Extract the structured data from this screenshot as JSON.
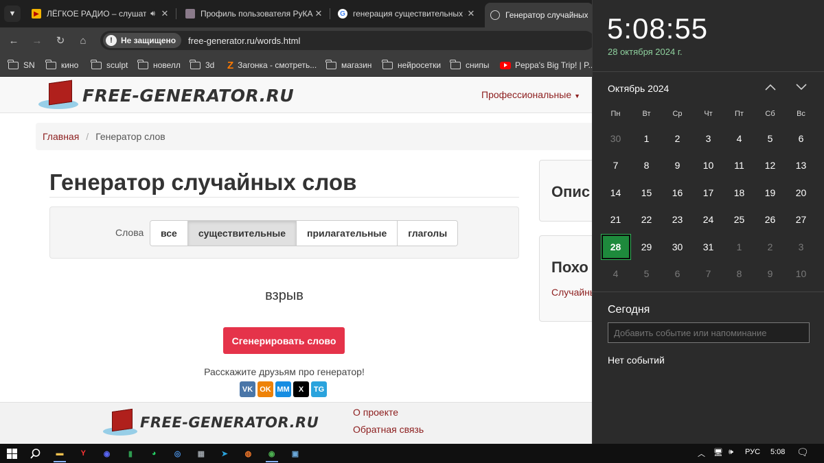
{
  "browser": {
    "tabs": [
      {
        "title": "ЛЁГКОЕ РАДИО – слушать",
        "favicon": "play-icon",
        "playing": true
      },
      {
        "title": "Профиль пользователя РуКАМ",
        "favicon": "site-favicon"
      },
      {
        "title": "генерация существительных -",
        "favicon": "google-icon"
      },
      {
        "title": "Генератор случайных сл",
        "favicon": "globe-icon",
        "active": true
      }
    ],
    "security_label": "Не защищено",
    "url": "free-generator.ru/words.html",
    "bookmarks": [
      {
        "label": "SN",
        "type": "folder"
      },
      {
        "label": "кино",
        "type": "folder"
      },
      {
        "label": "sculpt",
        "type": "folder"
      },
      {
        "label": "новелл",
        "type": "folder"
      },
      {
        "label": "3d",
        "type": "folder"
      },
      {
        "label": "Загонка - смотреть...",
        "type": "z-link"
      },
      {
        "label": "магазин",
        "type": "folder"
      },
      {
        "label": "нейросетки",
        "type": "folder"
      },
      {
        "label": "снипы",
        "type": "folder"
      },
      {
        "label": "Peppa's Big Trip! | P...",
        "type": "youtube-link"
      }
    ]
  },
  "site": {
    "logo_text": "FREE-GENERATOR.RU",
    "nav_menu": "Профессиональные",
    "breadcrumb": {
      "home": "Главная",
      "sep": "/",
      "current": "Генератор слов"
    },
    "title": "Генератор случайных слов",
    "filter_label": "Слова",
    "filters": [
      {
        "label": "все"
      },
      {
        "label": "существительные",
        "active": true
      },
      {
        "label": "прилагательные"
      },
      {
        "label": "глаголы"
      }
    ],
    "result": "взрыв",
    "generate_button": "Сгенерировать слово",
    "share_text": "Расскажите друзьям про генератор!",
    "share_buttons": [
      {
        "label": "VK",
        "icon": "vk-icon",
        "color": "#4a76a8"
      },
      {
        "label": "OK",
        "icon": "odnoklassniki-icon",
        "color": "#ee8208"
      },
      {
        "label": "MM",
        "icon": "mailru-icon",
        "color": "#168de2"
      },
      {
        "label": "X",
        "icon": "x-icon",
        "color": "#000000"
      },
      {
        "label": "TG",
        "icon": "telegram-icon",
        "color": "#2aa3dd"
      }
    ],
    "side_cards": [
      {
        "heading": "Опис"
      },
      {
        "heading": "Похо",
        "link": "Случайны"
      }
    ],
    "footer_links": [
      "О проекте",
      "Обратная связь"
    ],
    "accent_color": "#8c1d1d",
    "button_color": "#e5334a"
  },
  "calendar": {
    "time": "5:08:55",
    "date": "28 октября 2024 г.",
    "month_title": "Октябрь 2024",
    "weekdays": [
      "Пн",
      "Вт",
      "Ср",
      "Чт",
      "Пт",
      "Сб",
      "Вс"
    ],
    "days": [
      {
        "d": "30",
        "muted": true
      },
      {
        "d": "1"
      },
      {
        "d": "2"
      },
      {
        "d": "3"
      },
      {
        "d": "4"
      },
      {
        "d": "5"
      },
      {
        "d": "6"
      },
      {
        "d": "7"
      },
      {
        "d": "8"
      },
      {
        "d": "9"
      },
      {
        "d": "10"
      },
      {
        "d": "11"
      },
      {
        "d": "12"
      },
      {
        "d": "13"
      },
      {
        "d": "14"
      },
      {
        "d": "15"
      },
      {
        "d": "16"
      },
      {
        "d": "17"
      },
      {
        "d": "18"
      },
      {
        "d": "19"
      },
      {
        "d": "20"
      },
      {
        "d": "21"
      },
      {
        "d": "22"
      },
      {
        "d": "23"
      },
      {
        "d": "24"
      },
      {
        "d": "25"
      },
      {
        "d": "26"
      },
      {
        "d": "27"
      },
      {
        "d": "28",
        "today": true
      },
      {
        "d": "29"
      },
      {
        "d": "30"
      },
      {
        "d": "31"
      },
      {
        "d": "1",
        "muted": true
      },
      {
        "d": "2",
        "muted": true
      },
      {
        "d": "3",
        "muted": true
      },
      {
        "d": "4",
        "muted": true
      },
      {
        "d": "5",
        "muted": true
      },
      {
        "d": "6",
        "muted": true
      },
      {
        "d": "7",
        "muted": true
      },
      {
        "d": "8",
        "muted": true
      },
      {
        "d": "9",
        "muted": true
      },
      {
        "d": "10",
        "muted": true
      }
    ],
    "today_label": "Сегодня",
    "event_placeholder": "Добавить событие или напоминание",
    "no_events": "Нет событий",
    "today_color": "#1e8a3c"
  },
  "taskbar": {
    "apps": [
      {
        "icon": "file-explorer-icon",
        "glyph": "▬",
        "color": "#f2c14e"
      },
      {
        "icon": "yandex-browser-icon",
        "glyph": "Y",
        "color": "#ff3333"
      },
      {
        "icon": "discord-icon",
        "glyph": "◉",
        "color": "#5865f2"
      },
      {
        "icon": "app-icon",
        "glyph": "▮",
        "color": "#2e9b4f"
      },
      {
        "icon": "whatsapp-icon",
        "glyph": "◕",
        "color": "#25d366"
      },
      {
        "icon": "chromium-icon",
        "glyph": "◎",
        "color": "#4a90e2"
      },
      {
        "icon": "calculator-icon",
        "glyph": "▦",
        "color": "#9aa0a6"
      },
      {
        "icon": "telegram-icon",
        "glyph": "➤",
        "color": "#2aa3dd"
      },
      {
        "icon": "blender-icon",
        "glyph": "◍",
        "color": "#f5792a"
      },
      {
        "icon": "chrome-icon",
        "glyph": "◉",
        "color": "#4caf50"
      },
      {
        "icon": "photos-icon",
        "glyph": "▣",
        "color": "#6aa7d8"
      }
    ],
    "language": "РУС",
    "time": "5:08"
  }
}
